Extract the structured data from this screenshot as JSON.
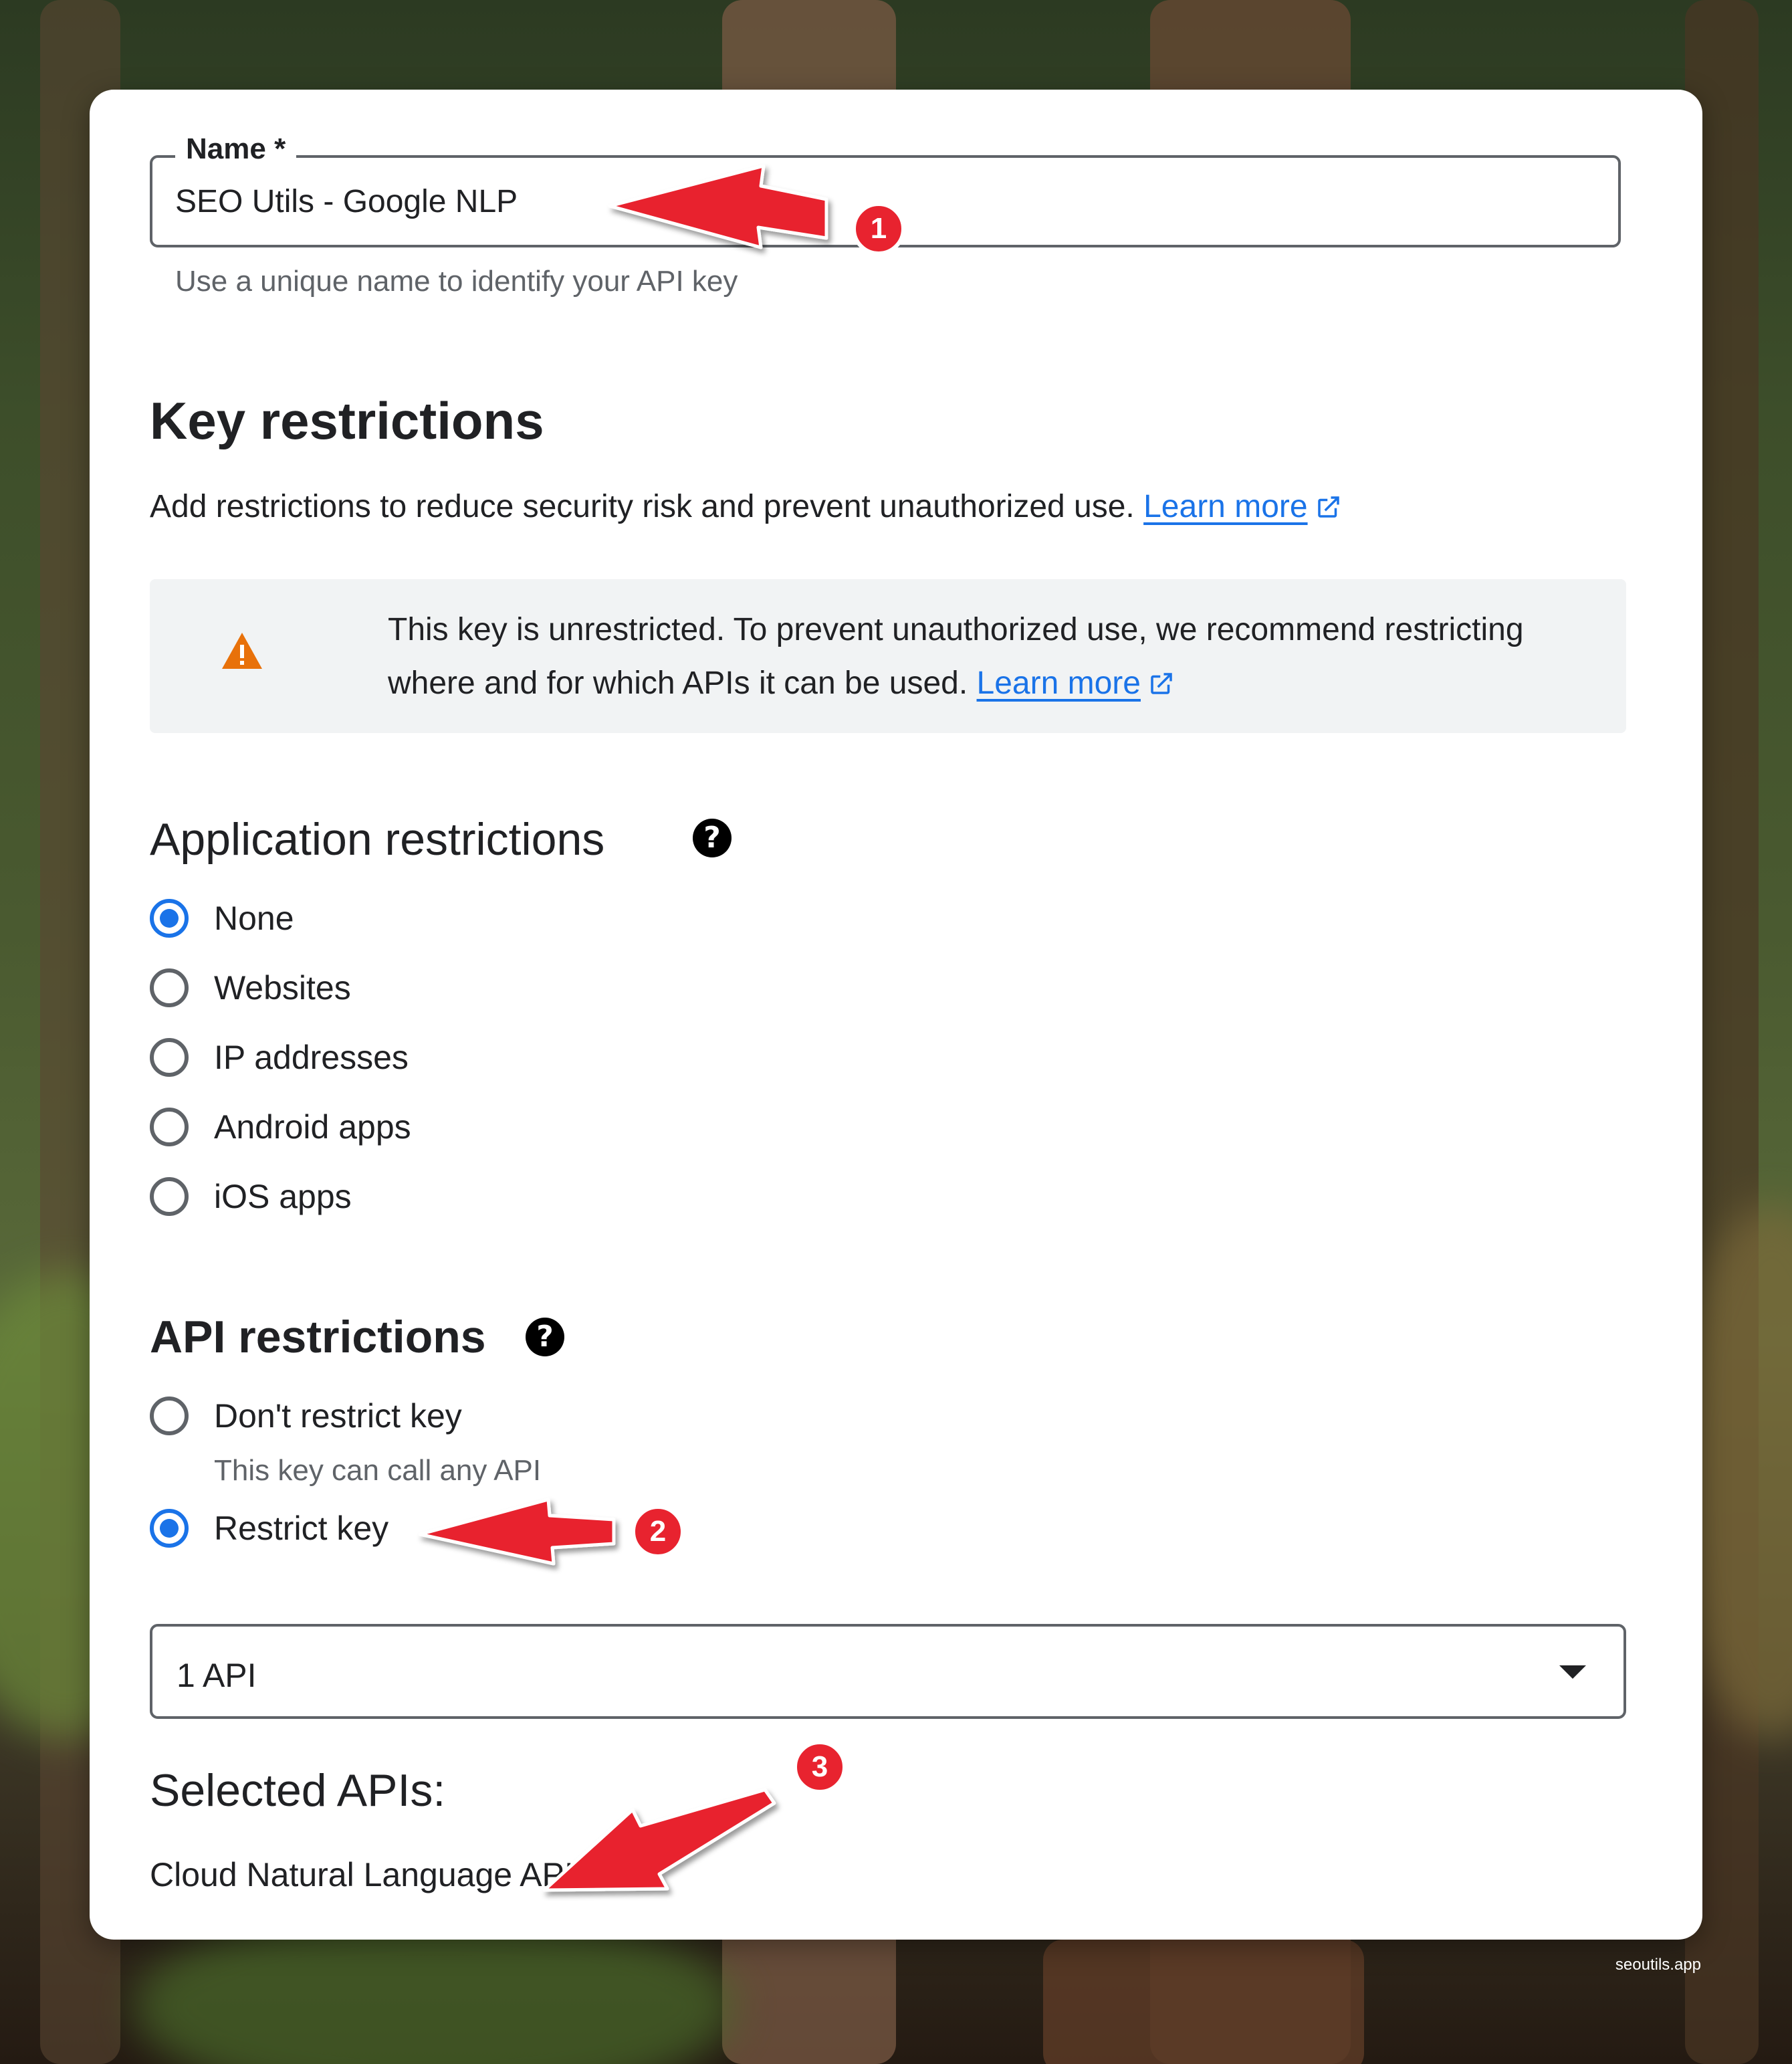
{
  "name_field": {
    "label": "Name *",
    "value": "SEO Utils - Google NLP",
    "helper": "Use a unique name to identify your API key"
  },
  "key_restrictions": {
    "title": "Key restrictions",
    "description": "Add restrictions to reduce security risk and prevent unauthorized use.",
    "learn_more": "Learn more"
  },
  "alert": {
    "text": "This key is unrestricted. To prevent unauthorized use, we recommend restricting where and for which APIs it can be used.",
    "learn_more": "Learn more",
    "icon": "warning-icon",
    "icon_color": "#e8710a"
  },
  "application_restrictions": {
    "title": "Application restrictions",
    "options": [
      "None",
      "Websites",
      "IP addresses",
      "Android apps",
      "iOS apps"
    ],
    "selected": "None"
  },
  "api_restrictions": {
    "title": "API restrictions",
    "options": [
      {
        "label": "Don't restrict key",
        "sub": "This key can call any API"
      },
      {
        "label": "Restrict key"
      }
    ],
    "selected": "Restrict key",
    "dropdown_value": "1 API"
  },
  "selected_apis": {
    "title": "Selected APIs:",
    "items": [
      "Cloud Natural Language API"
    ]
  },
  "annotations": {
    "badges": [
      "1",
      "2",
      "3"
    ],
    "color": "#e8232f"
  },
  "accent_color": "#1a73e8",
  "watermark": "seoutils.app"
}
